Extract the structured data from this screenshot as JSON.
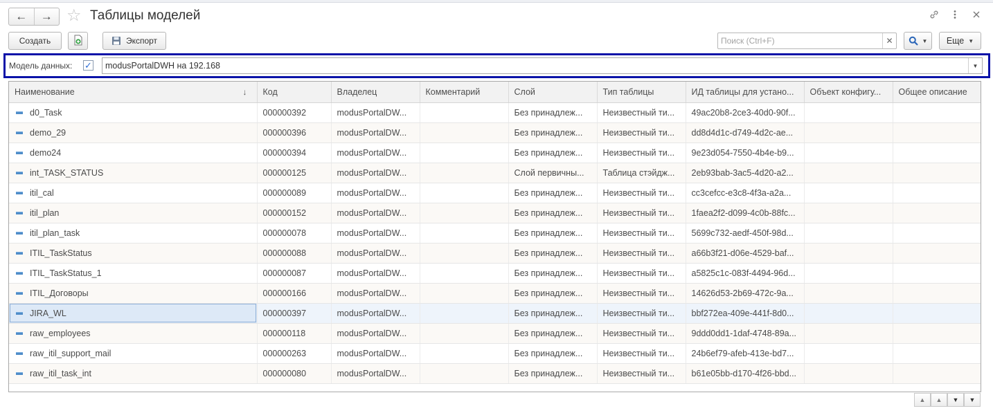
{
  "window": {
    "title": "Таблицы моделей"
  },
  "toolbar": {
    "create_label": "Создать",
    "export_label": "Экспорт",
    "search_placeholder": "Поиск (Ctrl+F)",
    "more_label": "Еще"
  },
  "filter": {
    "label": "Модель данных:",
    "checked": true,
    "value": "modusPortalDWH на 192.168"
  },
  "table": {
    "columns": [
      "Наименование",
      "Код",
      "Владелец",
      "Комментарий",
      "Слой",
      "Тип таблицы",
      "ИД таблицы для устано...",
      "Объект конфигу...",
      "Общее описание"
    ],
    "rows": [
      {
        "name": "d0_Task",
        "code": "000000392",
        "owner": "modusPortalDW...",
        "comment": "",
        "layer": "Без принадлеж...",
        "type": "Неизвестный ти...",
        "id": "49ac20b8-2ce3-40d0-90f...",
        "config": "",
        "desc": ""
      },
      {
        "name": "demo_29",
        "code": "000000396",
        "owner": "modusPortalDW...",
        "comment": "",
        "layer": "Без принадлеж...",
        "type": "Неизвестный ти...",
        "id": "dd8d4d1c-d749-4d2c-ae...",
        "config": "",
        "desc": ""
      },
      {
        "name": "demo24",
        "code": "000000394",
        "owner": "modusPortalDW...",
        "comment": "",
        "layer": "Без принадлеж...",
        "type": "Неизвестный ти...",
        "id": "9e23d054-7550-4b4e-b9...",
        "config": "",
        "desc": ""
      },
      {
        "name": "int_TASK_STATUS",
        "code": "000000125",
        "owner": "modusPortalDW...",
        "comment": "",
        "layer": "Слой первичны...",
        "type": "Таблица стэйдж...",
        "id": "2eb93bab-3ac5-4d20-a2...",
        "config": "",
        "desc": ""
      },
      {
        "name": "itil_cal",
        "code": "000000089",
        "owner": "modusPortalDW...",
        "comment": "",
        "layer": "Без принадлеж...",
        "type": "Неизвестный ти...",
        "id": "cc3cefcc-e3c8-4f3a-a2a...",
        "config": "",
        "desc": ""
      },
      {
        "name": "itil_plan",
        "code": "000000152",
        "owner": "modusPortalDW...",
        "comment": "",
        "layer": "Без принадлеж...",
        "type": "Неизвестный ти...",
        "id": "1faea2f2-d099-4c0b-88fc...",
        "config": "",
        "desc": ""
      },
      {
        "name": "itil_plan_task",
        "code": "000000078",
        "owner": "modusPortalDW...",
        "comment": "",
        "layer": "Без принадлеж...",
        "type": "Неизвестный ти...",
        "id": "5699c732-aedf-450f-98d...",
        "config": "",
        "desc": ""
      },
      {
        "name": "ITIL_TaskStatus",
        "code": "000000088",
        "owner": "modusPortalDW...",
        "comment": "",
        "layer": "Без принадлеж...",
        "type": "Неизвестный ти...",
        "id": "a66b3f21-d06e-4529-baf...",
        "config": "",
        "desc": ""
      },
      {
        "name": "ITIL_TaskStatus_1",
        "code": "000000087",
        "owner": "modusPortalDW...",
        "comment": "",
        "layer": "Без принадлеж...",
        "type": "Неизвестный ти...",
        "id": "a5825c1c-083f-4494-96d...",
        "config": "",
        "desc": ""
      },
      {
        "name": "ITIL_Договоры",
        "code": "000000166",
        "owner": "modusPortalDW...",
        "comment": "",
        "layer": "Без принадлеж...",
        "type": "Неизвестный ти...",
        "id": "14626d53-2b69-472c-9a...",
        "config": "",
        "desc": ""
      },
      {
        "name": "JIRA_WL",
        "code": "000000397",
        "owner": "modusPortalDW...",
        "comment": "",
        "layer": "Без принадлеж...",
        "type": "Неизвестный ти...",
        "id": "bbf272ea-409e-441f-8d0...",
        "config": "",
        "desc": ""
      },
      {
        "name": "raw_employees",
        "code": "000000118",
        "owner": "modusPortalDW...",
        "comment": "",
        "layer": "Без принадлеж...",
        "type": "Неизвестный ти...",
        "id": "9ddd0dd1-1daf-4748-89a...",
        "config": "",
        "desc": ""
      },
      {
        "name": "raw_itil_support_mail",
        "code": "000000263",
        "owner": "modusPortalDW...",
        "comment": "",
        "layer": "Без принадлеж...",
        "type": "Неизвестный ти...",
        "id": "24b6ef79-afeb-413e-bd7...",
        "config": "",
        "desc": ""
      },
      {
        "name": "raw_itil_task_int",
        "code": "000000080",
        "owner": "modusPortalDW...",
        "comment": "",
        "layer": "Без принадлеж...",
        "type": "Неизвестный ти...",
        "id": "b61e05bb-d170-4f26-bbd...",
        "config": "",
        "desc": ""
      }
    ],
    "selected_row": 10
  },
  "icons": {
    "back": "arrow-left-icon",
    "forward": "arrow-right-icon",
    "favorite": "star-icon",
    "link": "link-icon",
    "menu": "more-vertical-icon",
    "close": "close-icon",
    "add_copy": "add-document-icon",
    "export": "save-disk-icon",
    "search": "search-icon"
  },
  "colors": {
    "filter_border": "#0a12a8",
    "row_icon": "#4f8dc9",
    "checkbox": "#2e6fd6"
  }
}
